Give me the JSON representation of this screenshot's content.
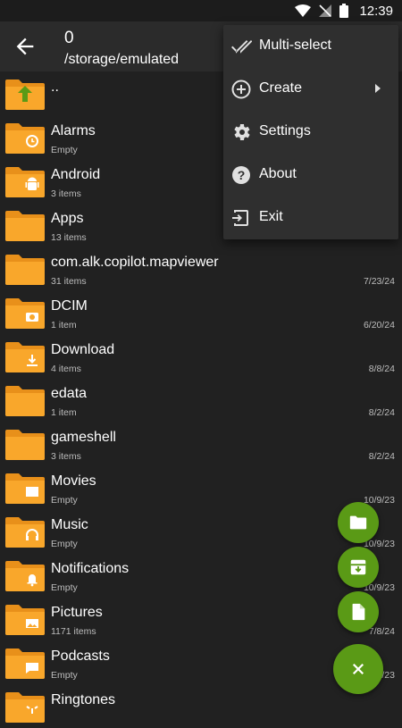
{
  "status_bar": {
    "time": "12:39"
  },
  "header": {
    "title": "0",
    "path": "/storage/emulated"
  },
  "menu": {
    "items": [
      {
        "label": "Multi-select",
        "icon": "double-check-icon"
      },
      {
        "label": "Create",
        "icon": "add-circle-icon",
        "has_submenu": true
      },
      {
        "label": "Settings",
        "icon": "gear-icon"
      },
      {
        "label": "About",
        "icon": "help-circle-icon"
      },
      {
        "label": "Exit",
        "icon": "exit-icon"
      }
    ]
  },
  "files": [
    {
      "name": "..",
      "sub": "",
      "date": "",
      "icon": "parent-folder-icon"
    },
    {
      "name": "Alarms",
      "sub": "Empty",
      "date": "",
      "icon": "alarm-folder-icon"
    },
    {
      "name": "Android",
      "sub": "3 items",
      "date": "",
      "icon": "android-folder-icon"
    },
    {
      "name": "Apps",
      "sub": "13 items",
      "date": "",
      "icon": "folder-icon"
    },
    {
      "name": "com.alk.copilot.mapviewer",
      "sub": "31 items",
      "date": "7/23/24",
      "icon": "folder-icon"
    },
    {
      "name": "DCIM",
      "sub": "1 item",
      "date": "6/20/24",
      "icon": "camera-folder-icon"
    },
    {
      "name": "Download",
      "sub": "4 items",
      "date": "8/8/24",
      "icon": "download-folder-icon"
    },
    {
      "name": "edata",
      "sub": "1 item",
      "date": "8/2/24",
      "icon": "folder-icon"
    },
    {
      "name": "gameshell",
      "sub": "3 items",
      "date": "8/2/24",
      "icon": "folder-icon"
    },
    {
      "name": "Movies",
      "sub": "Empty",
      "date": "10/9/23",
      "icon": "movie-folder-icon"
    },
    {
      "name": "Music",
      "sub": "Empty",
      "date": "10/9/23",
      "icon": "music-folder-icon"
    },
    {
      "name": "Notifications",
      "sub": "Empty",
      "date": "10/9/23",
      "icon": "notification-folder-icon"
    },
    {
      "name": "Pictures",
      "sub": "1171 items",
      "date": "7/8/24",
      "icon": "picture-folder-icon"
    },
    {
      "name": "Podcasts",
      "sub": "Empty",
      "date": "/23",
      "icon": "podcast-folder-icon"
    },
    {
      "name": "Ringtones",
      "sub": "",
      "date": "",
      "icon": "ringtone-folder-icon"
    }
  ],
  "fabs": [
    {
      "icon": "new-folder-icon"
    },
    {
      "icon": "archive-icon"
    },
    {
      "icon": "new-file-icon"
    },
    {
      "icon": "close-icon"
    }
  ],
  "colors": {
    "folder": "#F9A72B",
    "folder_dark": "#E8901A",
    "fab": "#5A9A16",
    "background": "#212121",
    "menu_bg": "#2F2F2F"
  }
}
